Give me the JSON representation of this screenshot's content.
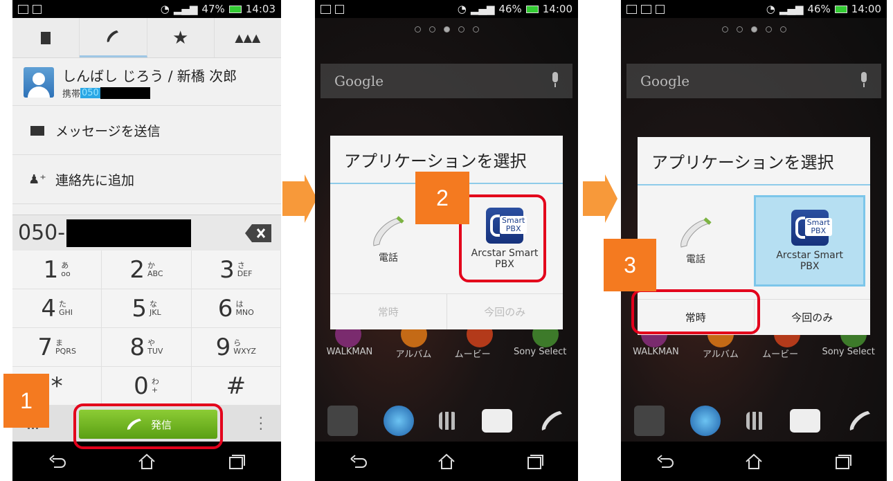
{
  "phone1": {
    "status": {
      "battery": "47%",
      "time": "14:03"
    },
    "tabs": [
      "contacts-icon",
      "phone-icon",
      "star-icon",
      "groups-icon"
    ],
    "contact": {
      "name": "しんばし じろう / 新橋 次郎",
      "type_label": "携帯",
      "number_prefix": "050"
    },
    "menu": [
      {
        "label": "メッセージを送信",
        "icon": "message-icon"
      },
      {
        "label": "連絡先に追加",
        "icon": "add-contact-icon"
      }
    ],
    "number_display": "050-",
    "keys": [
      {
        "digit": "1",
        "kana": "あ",
        "letters": "oo"
      },
      {
        "digit": "2",
        "kana": "か",
        "letters": "ABC"
      },
      {
        "digit": "3",
        "kana": "さ",
        "letters": "DEF"
      },
      {
        "digit": "4",
        "kana": "た",
        "letters": "GHI"
      },
      {
        "digit": "5",
        "kana": "な",
        "letters": "JKL"
      },
      {
        "digit": "6",
        "kana": "は",
        "letters": "MNO"
      },
      {
        "digit": "7",
        "kana": "ま",
        "letters": "PQRS"
      },
      {
        "digit": "8",
        "kana": "や",
        "letters": "TUV"
      },
      {
        "digit": "9",
        "kana": "ら",
        "letters": "WXYZ"
      },
      {
        "digit": "*",
        "kana": "",
        "letters": ""
      },
      {
        "digit": "0",
        "kana": "わ",
        "letters": "+"
      },
      {
        "digit": "#",
        "kana": "",
        "letters": ""
      }
    ],
    "call_label": "発信",
    "step": "1"
  },
  "phone2": {
    "status": {
      "battery": "46%",
      "time": "14:00"
    },
    "search_label": "Google",
    "dialog_title": "アプリケーションを選択",
    "option_phone": "電話",
    "option_pbx_line1": "Arcstar Smart",
    "option_pbx_line2": "PBX",
    "pbx_icon_text_1": "Smart",
    "pbx_icon_text_2": "PBX",
    "btn_always": "常時",
    "btn_once": "今回のみ",
    "apps": [
      "WALKMAN",
      "アルバム",
      "ムービー",
      "Sony Select"
    ],
    "step": "2"
  },
  "phone3": {
    "status": {
      "battery": "46%",
      "time": "14:00"
    },
    "search_label": "Google",
    "dialog_title": "アプリケーションを選択",
    "option_phone": "電話",
    "option_pbx_line1": "Arcstar Smart",
    "option_pbx_line2": "PBX",
    "pbx_icon_text_1": "Smart",
    "pbx_icon_text_2": "PBX",
    "btn_always": "常時",
    "btn_once": "今回のみ",
    "apps": [
      "WALKMAN",
      "アルバム",
      "ムービー",
      "Sony Select"
    ],
    "step": "3"
  },
  "colors": {
    "accent_orange": "#f47a20",
    "highlight_red": "#e3001b",
    "call_green": "#6fb11c",
    "selected_blue": "#b6dff2"
  }
}
